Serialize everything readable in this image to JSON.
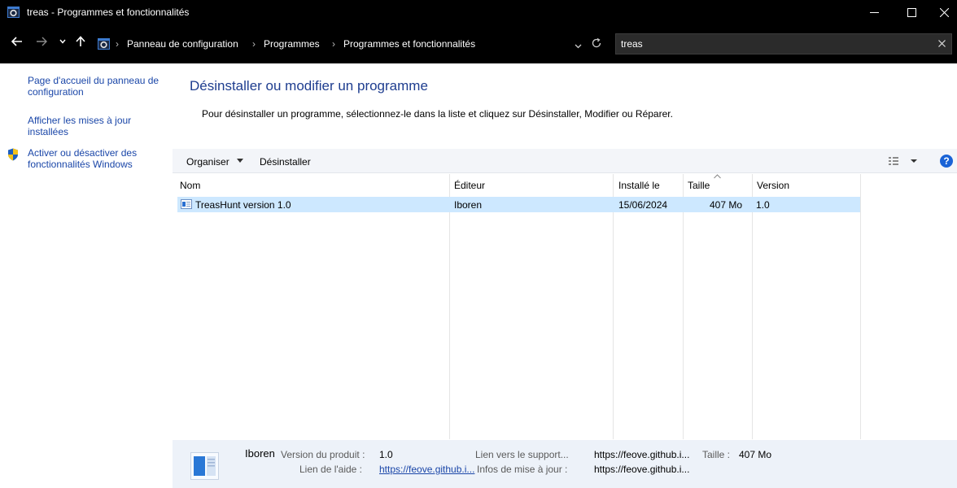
{
  "window": {
    "title": "treas - Programmes et fonctionnalités"
  },
  "address": {
    "breadcrumbs": [
      "Panneau de configuration",
      "Programmes",
      "Programmes et fonctionnalités"
    ],
    "search_value": "treas"
  },
  "sidebar": {
    "links": [
      "Page d'accueil du panneau de configuration",
      "Afficher les mises à jour installées",
      "Activer ou désactiver des fonctionnalités Windows"
    ]
  },
  "main": {
    "heading": "Désinstaller ou modifier un programme",
    "description": "Pour désinstaller un programme, sélectionnez-le dans la liste et cliquez sur Désinstaller, Modifier ou Réparer."
  },
  "toolbar": {
    "organize_label": "Organiser",
    "uninstall_label": "Désinstaller",
    "help_glyph": "?"
  },
  "list": {
    "columns": [
      "Nom",
      "Éditeur",
      "Installé le",
      "Taille",
      "Version"
    ],
    "rows": [
      {
        "name": "TreasHunt version 1.0",
        "publisher": "Iboren",
        "installed": "15/06/2024",
        "size": "407 Mo",
        "version": "1.0"
      }
    ]
  },
  "details": {
    "name": "Iboren",
    "product_version_label": "Version du produit :",
    "product_version": "1.0",
    "help_link_label": "Lien de l'aide :",
    "help_link": "https://feove.github.i...",
    "support_link_label": "Lien vers le support...",
    "support_link": "https://feove.github.i...",
    "update_info_label": "Infos de mise à jour :",
    "update_info": "https://feove.github.i...",
    "size_label": "Taille :",
    "size": "407 Mo"
  },
  "colors": {
    "titlebar_bg": "#000000",
    "link": "#1a46a8",
    "heading": "#1e3d8f",
    "selection": "#cde8ff",
    "details_bg": "#edf2f9"
  }
}
